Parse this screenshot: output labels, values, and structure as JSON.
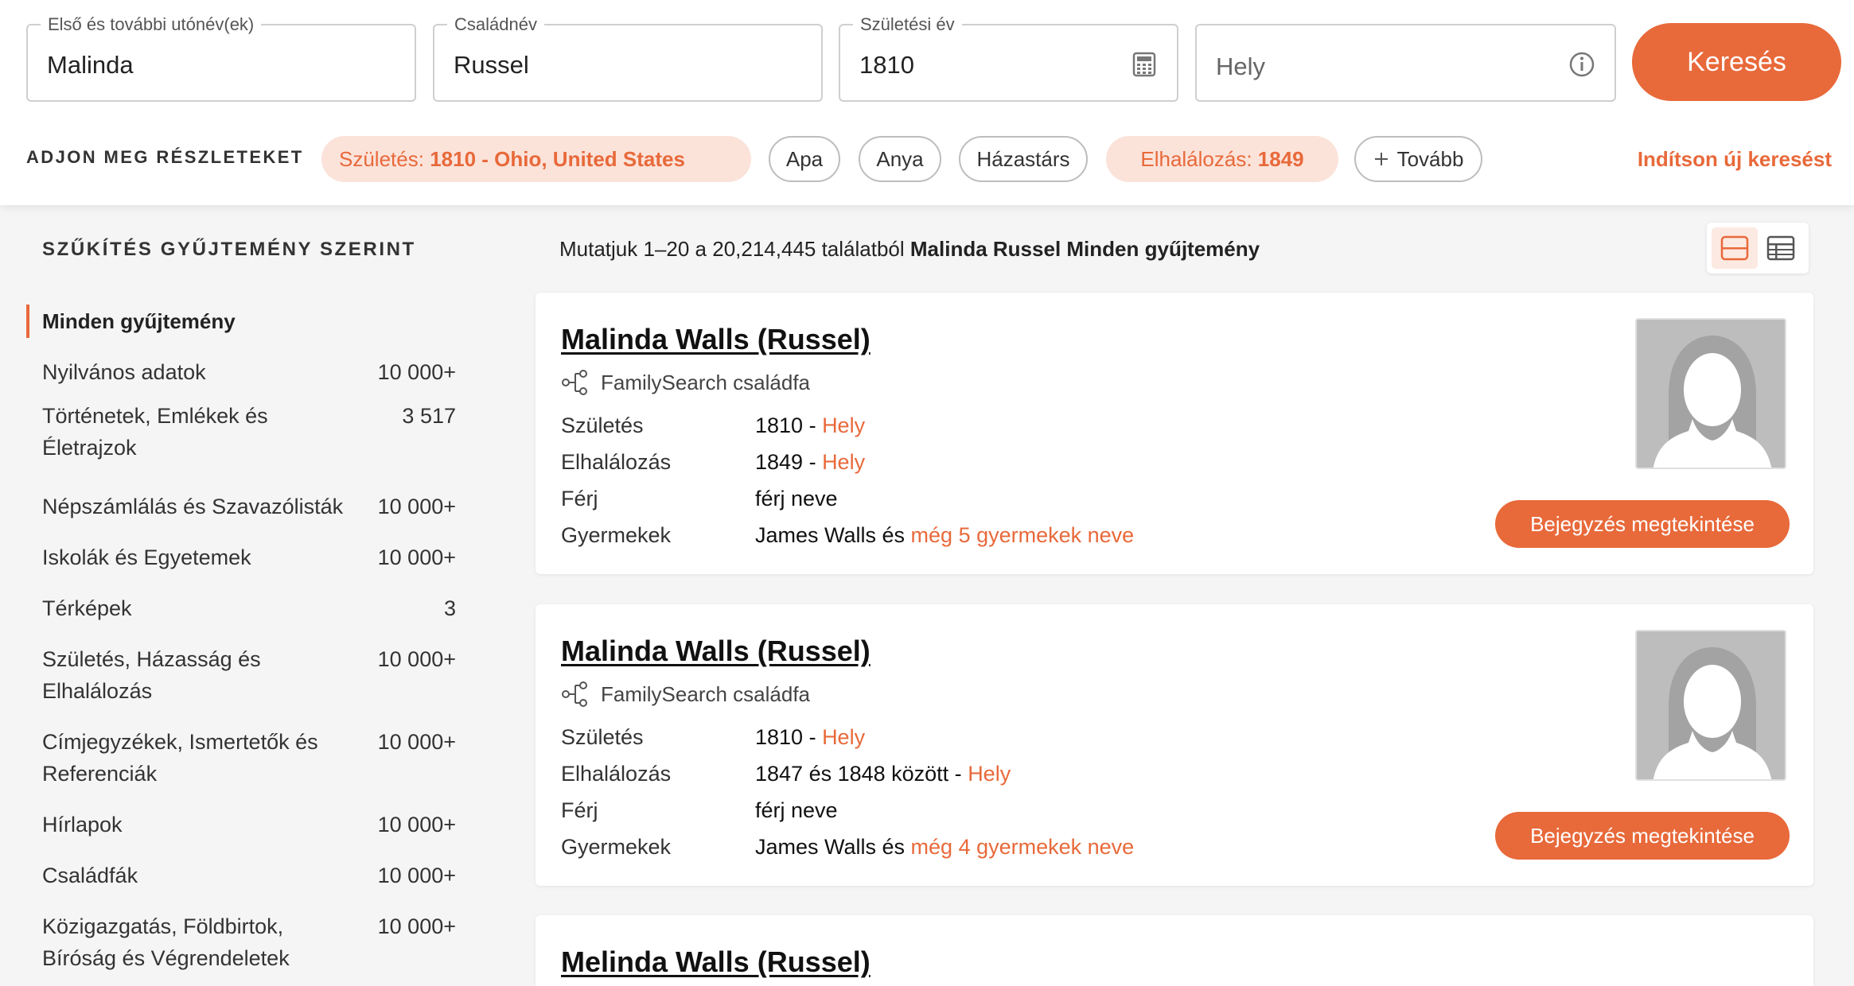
{
  "search": {
    "given_label": "Első és további utónév(ek)",
    "given_value": "Malinda",
    "surname_label": "Családnév",
    "surname_value": "Russel",
    "birthyear_label": "Születési év",
    "birthyear_value": "1810",
    "place_placeholder": "Hely",
    "button": "Keresés"
  },
  "details": {
    "label": "ADJON MEG RÉSZLETEKET",
    "birth_prefix": "Születés: ",
    "birth_value": "1810 - Ohio, United States",
    "father": "Apa",
    "mother": "Anya",
    "spouse": "Házastárs",
    "death_prefix": "Elhalálozás: ",
    "death_value": "1849",
    "more": "Tovább",
    "new_search": "Indítson új keresést"
  },
  "sidebar": {
    "title": "SZŰKÍTÉS GYŰJTEMÉNY SZERINT",
    "active": "Minden gyűjtemény",
    "items": [
      {
        "name": "Nyilvános adatok",
        "count": "10 000+"
      },
      {
        "name": "Történetek, Emlékek és Életrajzok",
        "count": "3 517"
      },
      {
        "name": "Népszámlálás és Szavazólisták",
        "count": "10 000+"
      },
      {
        "name": "Iskolák és Egyetemek",
        "count": "10 000+"
      },
      {
        "name": "Térképek",
        "count": "3"
      },
      {
        "name": "Születés, Házasság és Elhalálozás",
        "count": "10 000+"
      },
      {
        "name": "Címjegyzékek, Ismertetők és Referenciák",
        "count": "10 000+"
      },
      {
        "name": "Hírlapok",
        "count": "10 000+"
      },
      {
        "name": "Családfák",
        "count": "10 000+"
      },
      {
        "name": "Közigazgatás, Földbirtok, Bíróság és Végrendeletek",
        "count": "10 000+"
      }
    ]
  },
  "results": {
    "summary_prefix": "Mutatjuk 1–20 a 20,214,445 találatból ",
    "summary_bold": "Malinda Russel Minden gyűjtemény",
    "cards": [
      {
        "name": "Malinda Walls (Russel)",
        "source": "FamilySearch családfa",
        "birth_label": "Születés",
        "birth_value": "1810 - ",
        "birth_link": "Hely",
        "death_label": "Elhalálozás",
        "death_value": "1849 - ",
        "death_link": "Hely",
        "spouse_label": "Férj",
        "spouse_link": "férj neve",
        "children_label": "Gyermekek",
        "children_value": "James Walls és ",
        "children_link": "még 5 gyermekek neve",
        "button": "Bejegyzés megtekintése"
      },
      {
        "name": "Malinda Walls (Russel)",
        "source": "FamilySearch családfa",
        "birth_label": "Születés",
        "birth_value": "1810 - ",
        "birth_link": "Hely",
        "death_label": "Elhalálozás",
        "death_value": "1847 és 1848 között - ",
        "death_link": "Hely",
        "spouse_label": "Férj",
        "spouse_link": "férj neve",
        "children_label": "Gyermekek",
        "children_value": "James Walls és ",
        "children_link": "még 4 gyermekek neve",
        "button": "Bejegyzés megtekintése"
      },
      {
        "name": "Melinda Walls (Russel)"
      }
    ]
  },
  "icons": {
    "calendar": "calendar-icon",
    "info": "info-icon",
    "plus": "plus-icon",
    "tree": "family-tree-icon",
    "list_view": "list-view-icon",
    "table_view": "table-view-icon",
    "avatar": "female-silhouette-icon"
  },
  "colors": {
    "accent": "#e8693a",
    "accent_light": "#fbe3da"
  }
}
